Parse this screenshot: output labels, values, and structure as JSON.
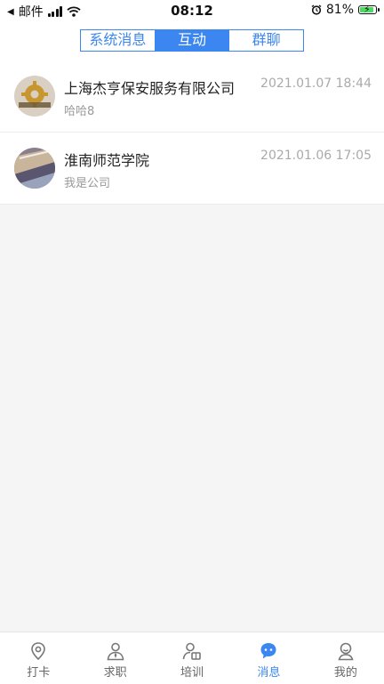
{
  "status_bar": {
    "carrier": "邮件",
    "time": "08:12",
    "battery_pct": "81%"
  },
  "segment": {
    "tabs": [
      {
        "label": "系统消息",
        "active": false
      },
      {
        "label": "互动",
        "active": true
      },
      {
        "label": "群聊",
        "active": false
      }
    ]
  },
  "conversations": [
    {
      "name": "上海杰亨保安服务有限公司",
      "time": "2021.01.07 18:44",
      "preview": "哈哈8"
    },
    {
      "name": "淮南师范学院",
      "time": "2021.01.06 17:05",
      "preview": "我是公司"
    }
  ],
  "tabbar": {
    "items": [
      {
        "label": "打卡",
        "icon": "location-pin-icon"
      },
      {
        "label": "求职",
        "icon": "person-tie-icon"
      },
      {
        "label": "培训",
        "icon": "person-book-icon"
      },
      {
        "label": "消息",
        "icon": "chat-bubble-icon"
      },
      {
        "label": "我的",
        "icon": "profile-icon"
      }
    ],
    "active_index": 3
  },
  "colors": {
    "accent": "#3b86f0",
    "battery_fill": "#4cd964"
  }
}
